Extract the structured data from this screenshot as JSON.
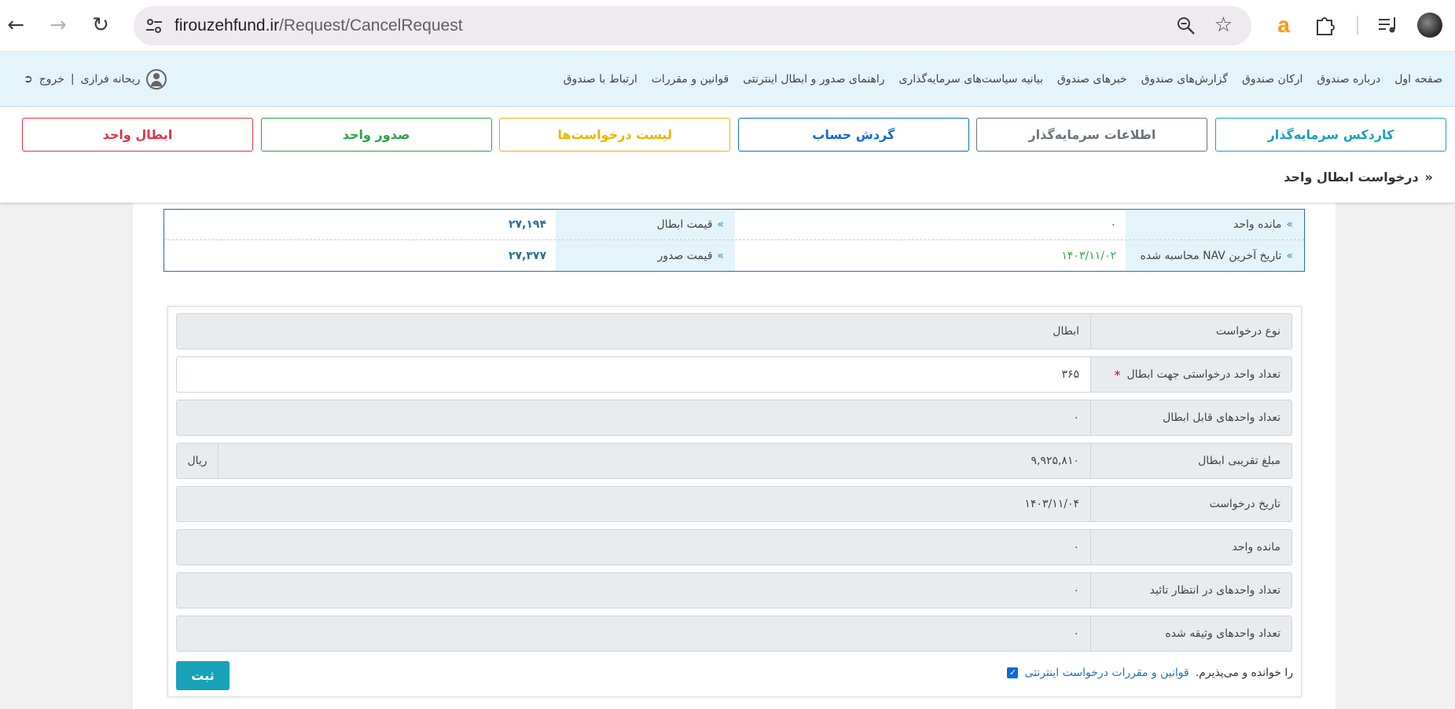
{
  "browser": {
    "url_host": "firouzehfund.ir",
    "url_path": "/Request/CancelRequest"
  },
  "header": {
    "nav": [
      "صفحه اول",
      "درباره صندوق",
      "ارکان صندوق",
      "گزارش‌های صندوق",
      "خبرهای صندوق",
      "بیانیه سیاست‌های سرمایه‌گذاری",
      "راهنمای صدور و ابطال اینترنتی",
      "قوانین و مقررات",
      "ارتباط با صندوق"
    ],
    "user_name": "ریحانه فرازی",
    "separator": "|",
    "logout": "خروج"
  },
  "actions": [
    {
      "label": "کاردکس سرمایه‌گذار",
      "color": "#17a2b8"
    },
    {
      "label": "اطلاعات سرمایه‌گذار",
      "color": "#6c757d"
    },
    {
      "label": "گردش حساب",
      "color": "#0b6bd6"
    },
    {
      "label": "لیست درخواست‌ها",
      "color": "#f0b400"
    },
    {
      "label": "صدور واحد",
      "color": "#28a745"
    },
    {
      "label": "ابطال واحد",
      "color": "#dc3545"
    }
  ],
  "breadcrumb": {
    "marker": "»",
    "title": "درخواست ابطال واحد"
  },
  "info": {
    "marker": "»",
    "row1": {
      "label_a": "مانده واحد",
      "value_a": "۰",
      "label_b": "قیمت ابطال",
      "value_b": "۲۷,۱۹۴"
    },
    "row2": {
      "label_a": "تاریخ آخرین NAV محاسبه شده",
      "value_a": "۱۴۰۳/۱۱/۰۲",
      "label_b": "قیمت صدور",
      "value_b": "۲۷,۳۷۷"
    }
  },
  "form": {
    "rows": [
      {
        "label": "نوع درخواست",
        "value": "ابطال"
      },
      {
        "label": "تعداد واحد درخواستی جهت ابطال",
        "value": "۳۶۵",
        "required": "*"
      },
      {
        "label": "تعداد واحدهای قابل ابطال",
        "value": "۰"
      },
      {
        "label": "مبلغ تقریبی ابطال",
        "value": "۹,۹۲۵,۸۱۰",
        "unit": "ریال"
      },
      {
        "label": "تاریخ درخواست",
        "value": "۱۴۰۳/۱۱/۰۴"
      },
      {
        "label": "مانده واحد",
        "value": "۰"
      },
      {
        "label": "تعداد واحدهای در انتظار تائید",
        "value": "۰"
      },
      {
        "label": "تعداد واحدهای وثیقه شده",
        "value": "۰"
      }
    ],
    "agree_link": "قوانین و مقررات درخواست اینترنتی",
    "agree_text": "را خوانده و می‌پذیرم.",
    "submit": "ثبت"
  }
}
